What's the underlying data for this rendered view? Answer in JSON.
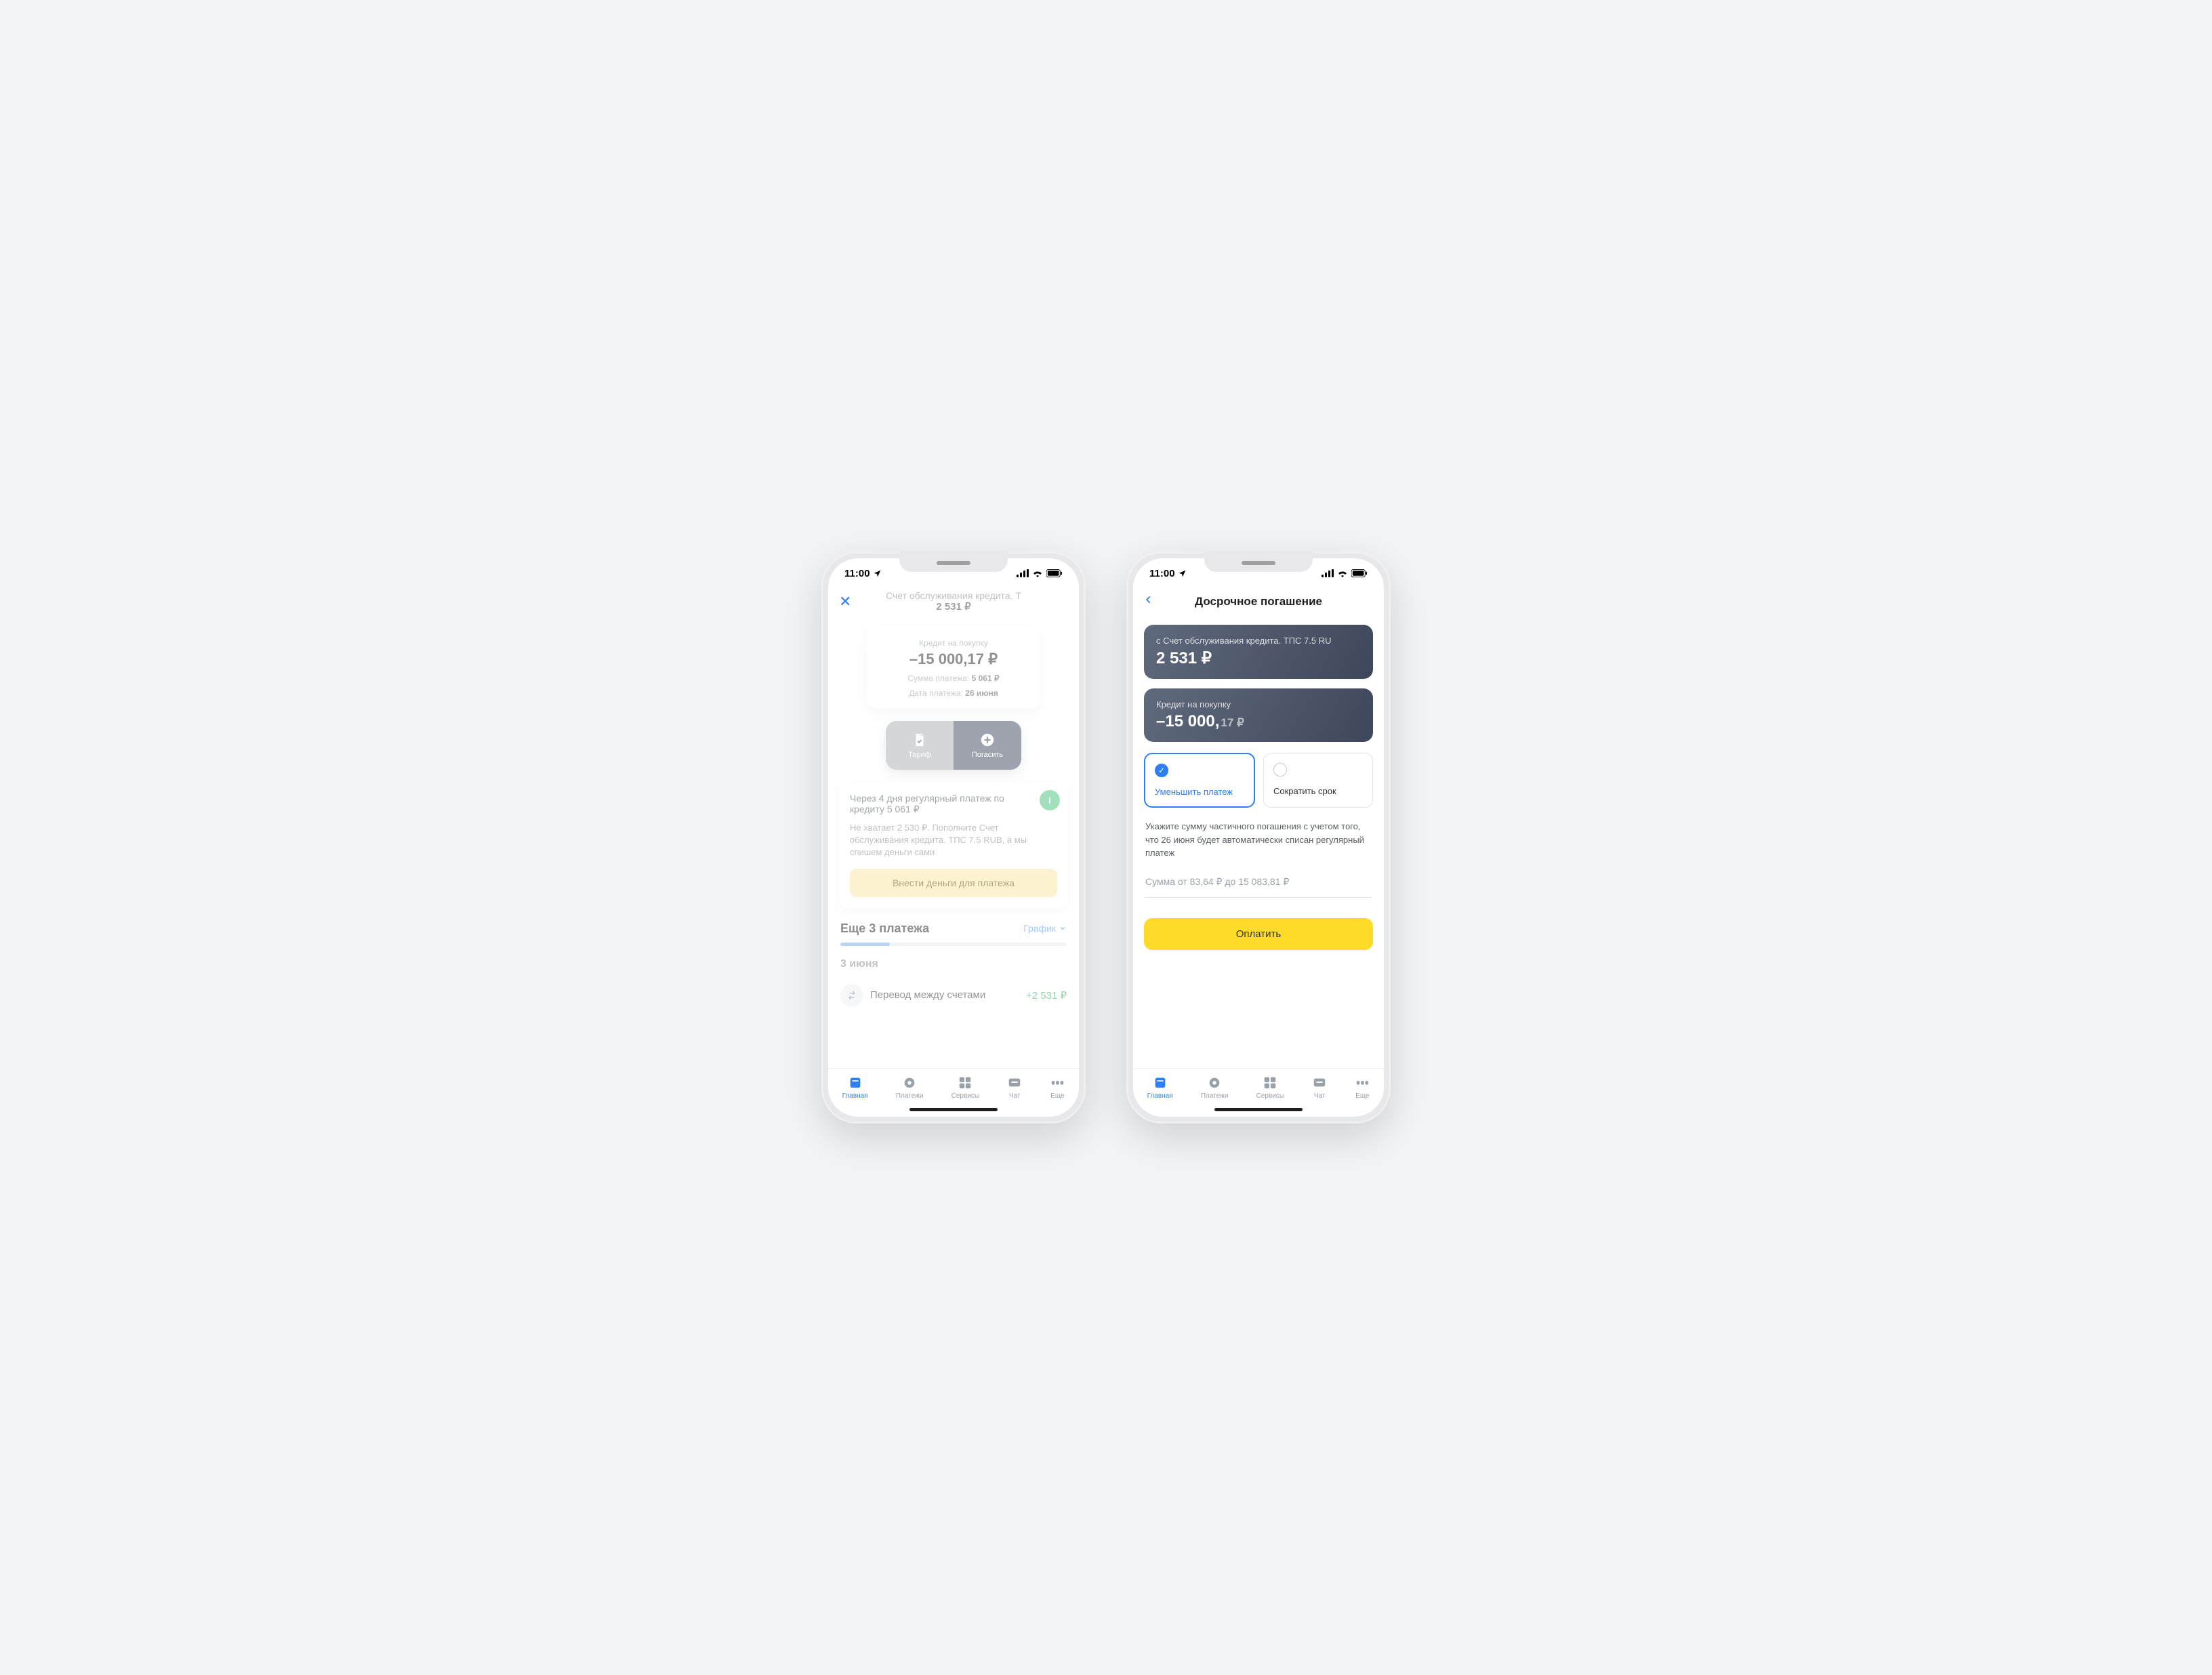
{
  "status": {
    "time": "11:00"
  },
  "tabs": {
    "items": [
      {
        "label": "Главная"
      },
      {
        "label": "Платежи"
      },
      {
        "label": "Сервисы"
      },
      {
        "label": "Чат"
      },
      {
        "label": "Еще"
      }
    ]
  },
  "screen1": {
    "nav": {
      "subtitle": "Счет обслуживания кредита. Т",
      "amount": "2 531 ₽"
    },
    "card": {
      "label": "Кредит на покупку",
      "balance": "–15 000,17 ₽",
      "sum_label": "Сумма платежа:",
      "sum_value": "5 061 ₽",
      "date_label": "Дата платежа:",
      "date_value": "26 июня"
    },
    "seg": {
      "left": "Тариф",
      "right": "Погасить"
    },
    "panel": {
      "line1": "Через 4 дня регулярный платеж по кредиту 5 061 ₽",
      "line2": "Не хватает 2 530 ₽. Пополните Счет обслуживания кредита. ТПС 7.5 RUB, а мы спишем деньги сами",
      "button": "Внести деньги для платежа"
    },
    "more": {
      "title": "Еще 3 платежа",
      "link": "График"
    },
    "date_header": "3 июня",
    "tx": {
      "name": "Перевод между счетами",
      "amount": "+2 531 ₽"
    }
  },
  "screen2": {
    "nav_title": "Досрочное погашение",
    "card1": {
      "title": "с Счет обслуживания кредита. ТПС 7.5 RU",
      "amount": "2 531 ₽"
    },
    "card2": {
      "title": "Кредит на покупку",
      "amount_int": "–15 000,",
      "amount_frac": "17 ₽"
    },
    "opt1": "Уменьшить платеж",
    "opt2": "Сократить срок",
    "hint": "Укажите сумму частичного погашения с учетом того, что 26 июня будет автоматически списан регулярный платеж",
    "sum_placeholder": "Сумма от 83,64 ₽ до 15 083,81 ₽",
    "pay": "Оплатить"
  }
}
